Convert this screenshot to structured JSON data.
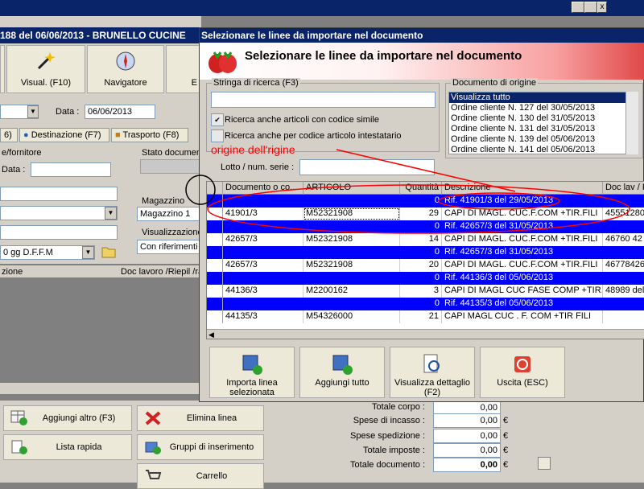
{
  "app": {
    "title": "188 del 06/06/2013 - BRUNELLO CUCINE",
    "close_glyph": "x"
  },
  "toolbar": {
    "visual_label": "Visual. (F10)",
    "navigatore_label": "Navigatore",
    "e_label": "E"
  },
  "form": {
    "data_label": "Data :",
    "data_value": "06/06/2013",
    "tab_partial": "6)",
    "tab_destinazione": "Destinazione (F7)",
    "tab_trasporto": "Trasporto (F8)",
    "fornitore_label": "e/fornitore",
    "data2_label": "Data :",
    "stato_label": "Stato documen",
    "magazzino_label": "Magazzino",
    "magazzino_value": "Magazzino 1",
    "visualizzazione_label": "Visualizzazione",
    "visualizzazione_value": "Con riferimenti",
    "pagamento_value": "0 gg D.F.F.M",
    "col_zione": "zione",
    "col_doc_lavoro": "Doc lavoro /Riepil /ra"
  },
  "bottom": {
    "aggiungi_altro": "Aggiungi altro (F3)",
    "elimina_linea": "Elimina linea",
    "lista_rapida": "Lista rapida",
    "gruppi_inserimento": "Gruppi di inserimento",
    "carrello": "Carrello",
    "totals": [
      {
        "label": "Totale corpo :",
        "value": "0,00",
        "unit": ""
      },
      {
        "label": "Spese di incasso :",
        "value": "0,00",
        "unit": "€"
      },
      {
        "label": "Spese spedizione :",
        "value": "0,00",
        "unit": "€"
      },
      {
        "label": "Totale imposte :",
        "value": "0,00",
        "unit": "€"
      },
      {
        "label": "Totale documento :",
        "value": "0,00",
        "unit": "€"
      }
    ]
  },
  "dialog": {
    "title": "Selezionare le linee da importare nel documento",
    "header": "Selezionare le linee da importare nel documento",
    "search_label": "Stringa di ricerca (F3)",
    "search_value": "",
    "chk_simile": "Ricerca anche articoli con codice simile",
    "chk_simile_checked": true,
    "chk_intestatario": "Ricerca anche per codice articolo intestatario",
    "chk_intestatario_checked": false,
    "lotto_label": "Lotto / num. serie :",
    "origin_group": "Documento di origine",
    "origin_items": [
      "Visualizza tutto",
      "Ordine cliente N. 127 del 30/05/2013",
      "Ordine cliente N. 130 del 31/05/2013",
      "Ordine cliente N. 131 del 31/05/2013",
      "Ordine cliente N. 139 del 05/06/2013",
      "Ordine cliente N. 141 del 05/06/2013"
    ],
    "annotation": "origine dell'rigine",
    "grid_headers": [
      "Documento o co...",
      "ARTICOLO",
      "Quantità",
      "Descrizione",
      "Doc lav / R"
    ],
    "grid_rows": [
      {
        "type": "blue",
        "doc": "",
        "art": "",
        "qty": "0",
        "desc": "Rif. 41901/3 del 29/05/2013",
        "doclav": ""
      },
      {
        "type": "white",
        "doc": "41901/3",
        "art": "M52321908",
        "qty": "29",
        "desc": "CAPI DI MAGL. CUC.F.COM +TIR.FILI",
        "doclav": "45551280"
      },
      {
        "type": "blue",
        "doc": "",
        "art": "",
        "qty": "0",
        "desc": "Rif. 42657/3 del 31/05/2013",
        "doclav": ""
      },
      {
        "type": "white",
        "doc": "42657/3",
        "art": "M52321908",
        "qty": "14",
        "desc": "CAPI DI MAGL. CUC.F.COM +TIR.FILI",
        "doclav": "46760  42"
      },
      {
        "type": "blue",
        "doc": "",
        "art": "",
        "qty": "0",
        "desc": "Rif. 42657/3 del 31/05/2013",
        "doclav": ""
      },
      {
        "type": "white",
        "doc": "42657/3",
        "art": "M52321908",
        "qty": "20",
        "desc": "CAPI DI MAGL. CUC.F.COM +TIR.FILI",
        "doclav": "46778426"
      },
      {
        "type": "blue",
        "doc": "",
        "art": "",
        "qty": "0",
        "desc": "Rif. 44136/3 del 05/06/2013",
        "doclav": ""
      },
      {
        "type": "white",
        "doc": "44136/3",
        "art": "M2200162",
        "qty": "3",
        "desc": "CAPI DI MAGL CUC FASE COMP +TIR...",
        "doclav": "48989 del"
      },
      {
        "type": "blue",
        "doc": "",
        "art": "",
        "qty": "0",
        "desc": "Rif. 44135/3 del 05/06/2013",
        "doclav": ""
      },
      {
        "type": "white",
        "doc": "44135/3",
        "art": "M54326000",
        "qty": "21",
        "desc": "CAPI MAGL CUC . F. COM +TIR FILI",
        "doclav": ""
      }
    ],
    "btn_importa": "Importa linea selezionata",
    "btn_aggiungi_tutto": "Aggiungi tutto",
    "btn_dettaglio": "Visualizza dettaglio (F2)",
    "btn_uscita": "Uscita (ESC)"
  },
  "colors": {
    "selected_row": "#0000ff",
    "title_bar": "#0a246a",
    "annotation": "#ff0000"
  }
}
